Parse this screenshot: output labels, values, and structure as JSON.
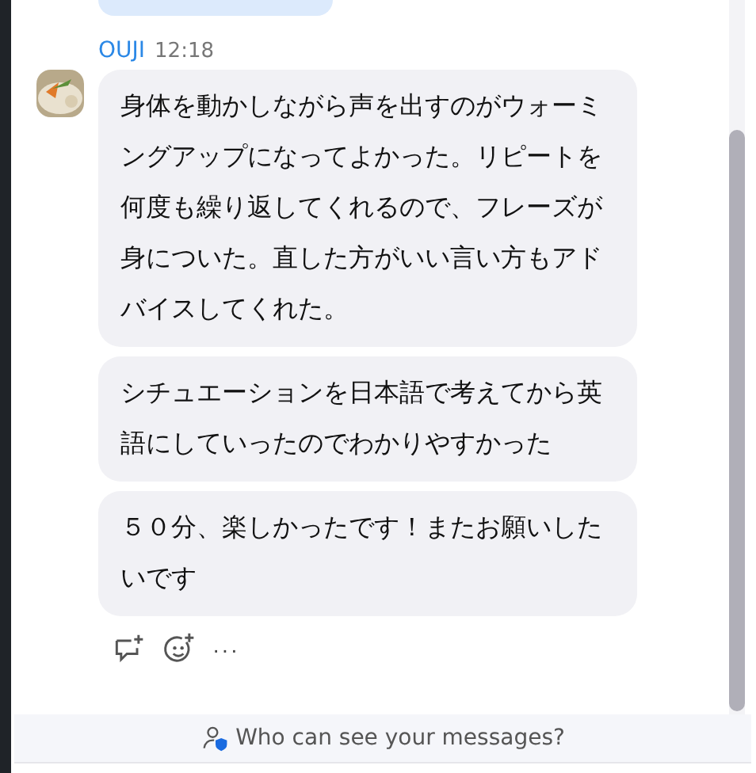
{
  "message_group": {
    "sender": "OUJI",
    "time": "12:18",
    "messages": [
      {
        "text": "身体を動かしながら声を出すのがウォーミングアップになってよかった。リピートを何度も繰り返してくれるので、フレーズが身についた。直した方がいい言い方もアドバイスしてくれた。"
      },
      {
        "text": "シチュエーションを日本語で考えてから英語にしていったのでわかりやすかった"
      },
      {
        "text": "５０分、楽しかったです！またお願いしたいです"
      }
    ],
    "actions": [
      "···"
    ]
  },
  "footer": {
    "privacy_link": "Who can see your messages?"
  }
}
